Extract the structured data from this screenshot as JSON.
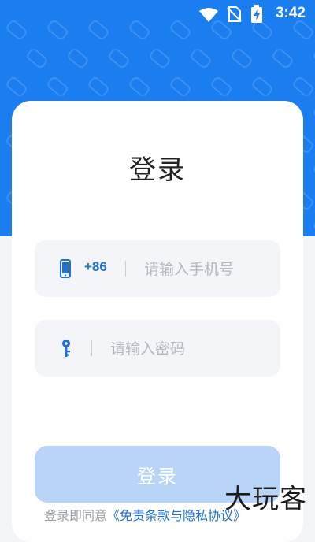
{
  "status_bar": {
    "time": "3:42",
    "icons": [
      "wifi-icon",
      "no-sim-icon",
      "battery-charging-icon"
    ]
  },
  "login": {
    "title": "登录",
    "phone": {
      "icon": "mobile-phone-icon",
      "country_code": "+86",
      "placeholder": "请输入手机号",
      "value": ""
    },
    "password": {
      "icon": "key-icon",
      "placeholder": "请输入密码",
      "value": ""
    },
    "submit_label": "登录",
    "agreement_prefix": "登录即同意",
    "agreement_link": "《免责条款与隐私协议》"
  },
  "watermark": "大玩客",
  "colors": {
    "brand_blue": "#1a7df0",
    "button_disabled": "#b8d5f8",
    "field_bg": "#f3f5f8",
    "link": "#1f6fd6"
  }
}
